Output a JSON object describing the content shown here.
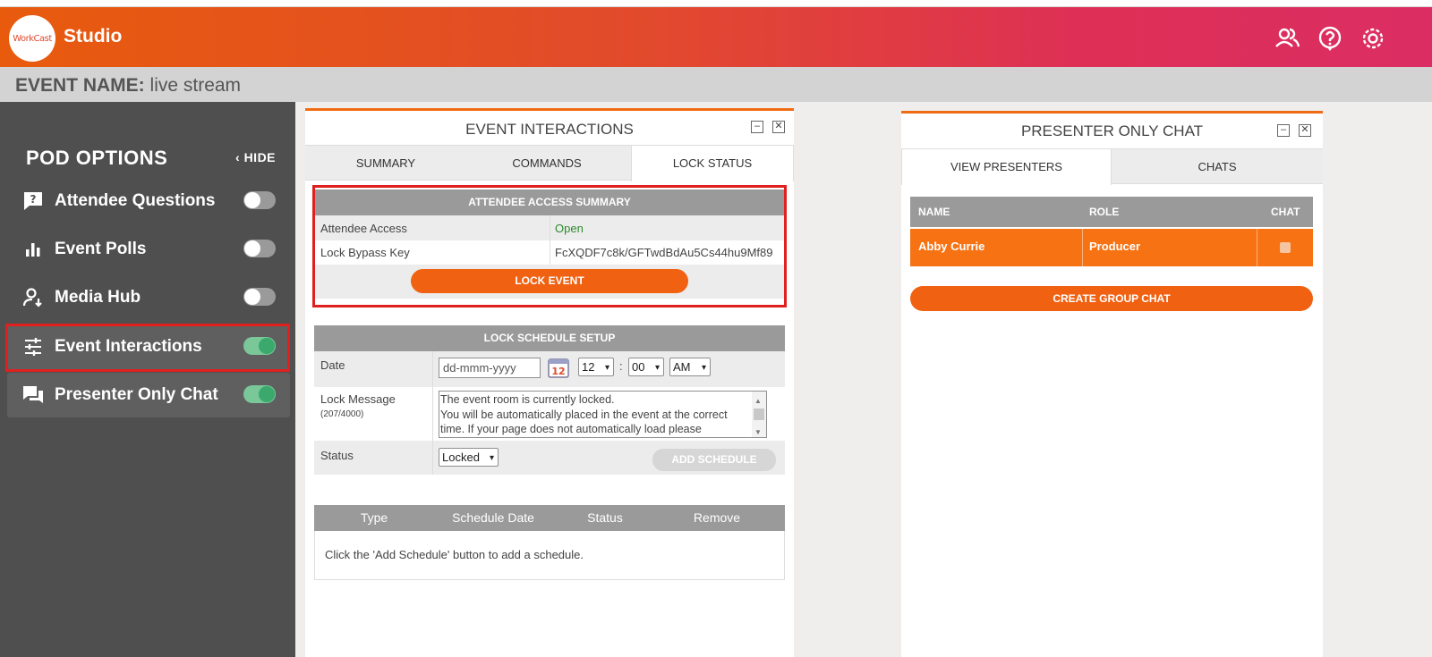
{
  "app": {
    "logo_text": "WorkCast",
    "title": "Studio"
  },
  "header_icons": [
    "users-icon",
    "help-icon",
    "settings-icon"
  ],
  "event_bar": {
    "label": "EVENT NAME:",
    "value": "live stream"
  },
  "sidebar": {
    "title": "POD OPTIONS",
    "hide_label": "HIDE",
    "items": [
      {
        "label": "Attendee Questions",
        "icon": "question-bubble-icon",
        "enabled": false
      },
      {
        "label": "Event Polls",
        "icon": "bar-chart-icon",
        "enabled": false
      },
      {
        "label": "Media Hub",
        "icon": "user-download-icon",
        "enabled": false
      },
      {
        "label": "Event Interactions",
        "icon": "sliders-icon",
        "enabled": true
      },
      {
        "label": "Presenter Only Chat",
        "icon": "chat-icon",
        "enabled": true
      }
    ]
  },
  "event_interactions": {
    "title": "EVENT INTERACTIONS",
    "tabs": [
      "SUMMARY",
      "COMMANDS",
      "LOCK STATUS"
    ],
    "selected_tab": "LOCK STATUS",
    "access_summary": {
      "header": "ATTENDEE ACCESS SUMMARY",
      "rows": [
        {
          "label": "Attendee Access",
          "value": "Open"
        },
        {
          "label": "Lock Bypass Key",
          "value": "FcXQDF7c8k/GFTwdBdAu5Cs44hu9Mf89"
        }
      ],
      "button": "LOCK EVENT"
    },
    "lock_schedule": {
      "header": "LOCK SCHEDULE SETUP",
      "date_label": "Date",
      "date_placeholder": "dd-mmm-yyyy",
      "calendar_day": "12",
      "hour": "12",
      "minute": "00",
      "ampm": "AM",
      "message_label": "Lock Message",
      "message_count": "(207/4000)",
      "message_lines": [
        "The event room is currently locked.",
        "You will be automatically placed in the event at the correct",
        "time. If your page does not automatically load please"
      ],
      "status_label": "Status",
      "status_value": "Locked",
      "add_button": "ADD SCHEDULE"
    },
    "schedule_table": {
      "columns": [
        "Type",
        "Schedule Date",
        "Status",
        "Remove"
      ],
      "empty_text": "Click the 'Add Schedule' button to add a schedule."
    }
  },
  "presenter_chat": {
    "title": "PRESENTER ONLY CHAT",
    "tabs": [
      "VIEW PRESENTERS",
      "CHATS"
    ],
    "selected_tab": "VIEW PRESENTERS",
    "columns": [
      "NAME",
      "ROLE",
      "CHAT"
    ],
    "rows": [
      {
        "name": "Abby Currie",
        "role": "Producer"
      }
    ],
    "button": "CREATE GROUP CHAT"
  },
  "colors": {
    "accent": "#f06112",
    "toggle_on": "#3aa96b",
    "highlight": "#e0201f",
    "open_status": "#2a8a2a"
  }
}
